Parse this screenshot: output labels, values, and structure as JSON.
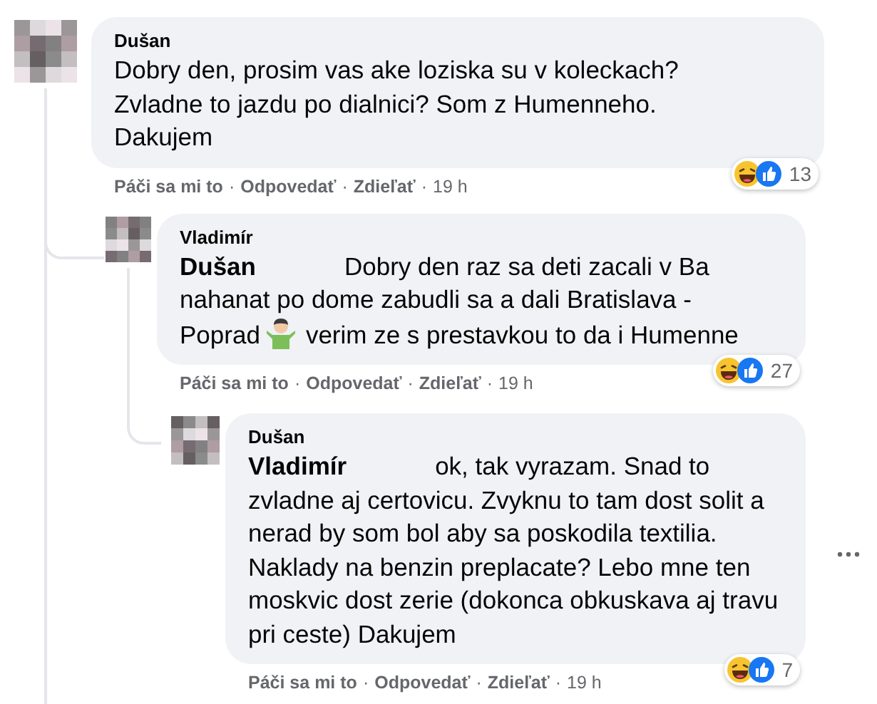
{
  "comments": [
    {
      "author": "Dušan",
      "text_before": "Dobry den, prosim vas ake loziska su v koleckach? Zvladne to jazdu po dialnici? Som z Humenneho. Dakujem",
      "reactions": [
        {
          "kind": "haha"
        },
        {
          "kind": "like"
        }
      ],
      "reaction_count": "13",
      "actions": [
        "Páči sa mi to",
        "Odpovedať",
        "Zdieľať"
      ],
      "separator": "·",
      "time": "19 h",
      "menu_visible": false,
      "replies": [
        {
          "author": "Vladimír",
          "mention": "Dušan",
          "text_before": "Dobry den raz sa deti zacali v Ba nahanat po dome zabudli sa a dali Bratislava - Poprad",
          "inline_icon": {
            "kind": "shrug"
          },
          "text_after": "verim ze s prestavkou to da i Humenne",
          "reactions": [
            {
              "kind": "haha"
            },
            {
              "kind": "like"
            }
          ],
          "reaction_count": "27",
          "actions": [
            "Páči sa mi to",
            "Odpovedať",
            "Zdieľať"
          ],
          "separator": "·",
          "time": "19 h",
          "menu_visible": false,
          "replies": [
            {
              "author": "Dušan",
              "mention": "Vladimír",
              "text_before": "ok, tak vyrazam. Snad to zvladne aj certovicu. Zvyknu to tam dost solit a nerad by som bol aby sa poskodila textilia. Naklady na benzin preplacate? Lebo mne ten moskvic dost zerie (dokonca obkuskava aj travu pri ceste) Dakujem",
              "reactions": [
                {
                  "kind": "haha"
                },
                {
                  "kind": "like"
                }
              ],
              "reaction_count": "7",
              "actions": [
                "Páči sa mi to",
                "Odpovedať",
                "Zdieľať"
              ],
              "separator": "·",
              "time": "19 h",
              "menu_visible": true
            }
          ]
        }
      ]
    }
  ]
}
